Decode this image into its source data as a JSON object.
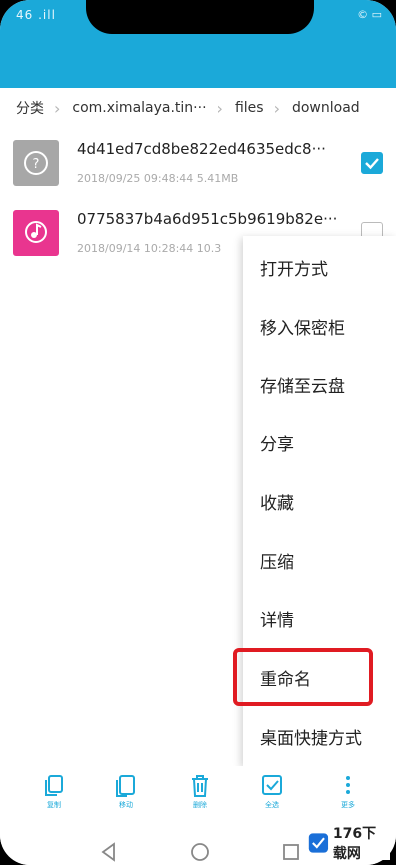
{
  "status_bar": {
    "left": "46 .ill",
    "right": "© ▭"
  },
  "breadcrumb": [
    "分类",
    "com.ximalaya.tin···",
    "files",
    "download"
  ],
  "files": [
    {
      "name": "4d41ed7cd8be822ed4635edc8···",
      "meta": "2018/09/25 09:48:44 5.41MB",
      "checked": true,
      "thumb_icon": "unknown-file-icon",
      "thumb_color": "#a7a7a7"
    },
    {
      "name": "0775837b4a6d951c5b9619b82e···",
      "meta": "2018/09/14 10:28:44 10.3",
      "checked": false,
      "thumb_icon": "music-file-icon",
      "thumb_color": "#e9358f"
    }
  ],
  "menu": {
    "items": [
      "打开方式",
      "移入保密柜",
      "存储至云盘",
      "分享",
      "收藏",
      "压缩",
      "详情",
      "重命名",
      "桌面快捷方式"
    ],
    "highlighted_item": "重命名",
    "highlight_color": "#e01b22"
  },
  "toolbar": {
    "items": [
      {
        "icon": "copy-icon",
        "label": "复制"
      },
      {
        "icon": "move-icon",
        "label": "移动"
      },
      {
        "icon": "delete-icon",
        "label": "删除"
      },
      {
        "icon": "select-all-icon",
        "label": "全选"
      },
      {
        "icon": "more-icon",
        "label": "更多"
      }
    ]
  },
  "navbar": {
    "icons": [
      "back-icon",
      "home-icon",
      "recents-icon"
    ]
  },
  "watermark": {
    "text": "176下载网"
  },
  "colors": {
    "accent": "#1ba9d9"
  }
}
